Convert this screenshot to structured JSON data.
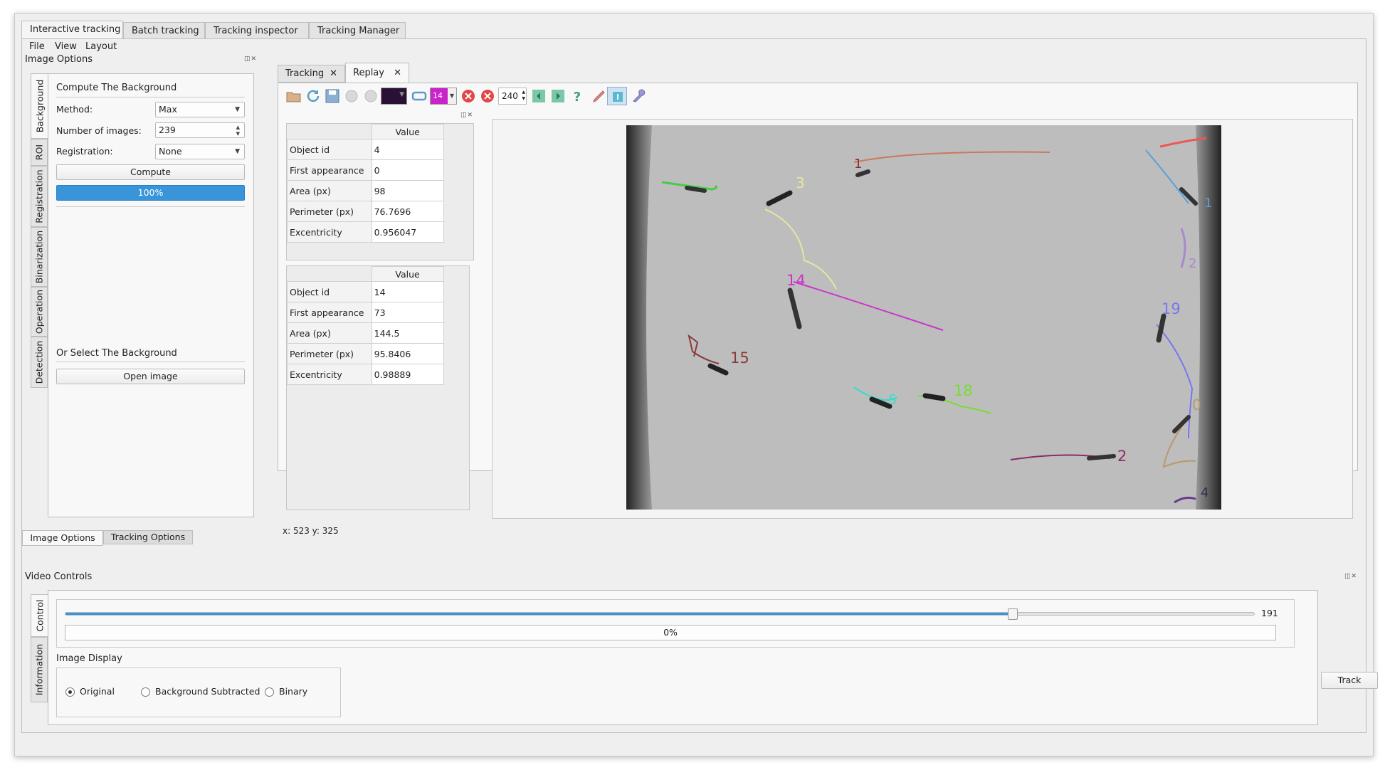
{
  "top_tabs": [
    "Interactive tracking",
    "Batch tracking",
    "Tracking inspector",
    "Tracking Manager"
  ],
  "menu": [
    "File",
    "View",
    "Layout"
  ],
  "image_options": {
    "title": "Image Options",
    "vertical_tabs": [
      "Background",
      "ROI",
      "Registration",
      "Binarization",
      "Operation",
      "Detection"
    ],
    "compute_heading": "Compute The Background",
    "method_label": "Method:",
    "method_value": "Max",
    "num_images_label": "Number of images:",
    "num_images_value": "239",
    "registration_label": "Registration:",
    "registration_value": "None",
    "compute_button": "Compute",
    "progress_text": "100%",
    "progress_value": 1.0,
    "select_heading": "Or Select The Background",
    "open_image_button": "Open image"
  },
  "bottom_left_tabs": [
    "Image Options",
    "Tracking Options"
  ],
  "view_tabs": [
    "Tracking",
    "Replay"
  ],
  "toolbar": {
    "color_value": "",
    "object_value": "14",
    "frame_spin_value": "240"
  },
  "table1": {
    "header": "Value",
    "rows": [
      {
        "key": "Object id",
        "value": "4"
      },
      {
        "key": "First appearance",
        "value": "0"
      },
      {
        "key": "Area (px)",
        "value": "98"
      },
      {
        "key": "Perimeter (px)",
        "value": "76.7696"
      },
      {
        "key": "Excentricity",
        "value": "0.956047"
      }
    ]
  },
  "table2": {
    "header": "Value",
    "rows": [
      {
        "key": "Object id",
        "value": "14"
      },
      {
        "key": "First appearance",
        "value": "73"
      },
      {
        "key": "Area (px)",
        "value": "144.5"
      },
      {
        "key": "Perimeter (px)",
        "value": "95.8406"
      },
      {
        "key": "Excentricity",
        "value": "0.98889"
      }
    ]
  },
  "coordinates": "x: 523 y: 325",
  "track_labels": [
    "1",
    "3",
    "14",
    "15",
    "5",
    "18",
    "19",
    "0",
    "2",
    "4",
    "1",
    "2"
  ],
  "track_colors": {
    "id1": "#c87a5a",
    "id3": "#e6e6a0",
    "id14": "#cc33cc",
    "id15": "#8b3a3a",
    "id5": "#33ddcc",
    "id18": "#77dd33",
    "id19": "#7777ee",
    "id0": "#b8996a",
    "id2": "#8b2a6b",
    "id4": "#6a3a8a",
    "topright": "#ee5555",
    "right1": "#5aa0dd",
    "right2": "#aa88cc",
    "green_left": "#44cc44"
  },
  "video_controls": {
    "title": "Video Controls",
    "vertical_tabs": [
      "Control",
      "Information"
    ],
    "slider_value": "191",
    "slider_fraction": 0.797,
    "progress_text": "0%",
    "image_display_label": "Image Display",
    "radio_options": [
      "Original",
      "Background Subtracted",
      "Binary"
    ],
    "selected_radio": "Original",
    "track_button": "Track"
  }
}
